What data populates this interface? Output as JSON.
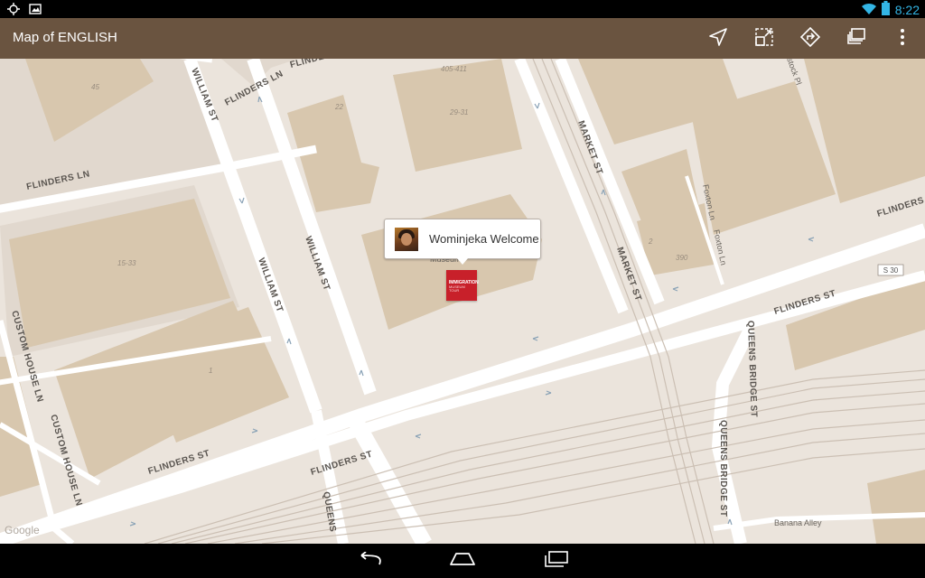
{
  "status_bar": {
    "time": "8:22",
    "icons": [
      "gps-icon",
      "gallery-notification-icon",
      "wifi-icon",
      "battery-icon"
    ]
  },
  "action_bar": {
    "title": "Map of ENGLISH",
    "actions": [
      "navigation-arrow-icon",
      "expand-view-icon",
      "directions-icon",
      "layers-icon",
      "overflow-menu-icon"
    ]
  },
  "map": {
    "callout": {
      "text": "Wominjeka Welcome"
    },
    "marker": {
      "line1": "IMMIGRATION",
      "line2": "MUSEUM",
      "line3": "TOUR"
    },
    "place_label": "Museum",
    "street_labels": {
      "william_st_1": "WILLIAM ST",
      "william_st_2": "WILLIAM ST",
      "william_st_3": "WILLIAM ST",
      "flinders_ln_1": "FLINDERS LN",
      "flinders_ln_2": "FLINDERS LN",
      "flinders_ln_3": "FLINDERS LN",
      "flinders_ln_4": "FLINDERS LN",
      "flinders_st_1": "FLINDERS ST",
      "flinders_st_2": "FLINDERS ST",
      "flinders_st_3": "FLINDERS ST",
      "market_st": "MARKET ST",
      "custom_house_ln_1": "CUSTOM HOUSE LN",
      "custom_house_ln_2": "CUSTOM HOUSE LN",
      "queens_bridge_st_1": "QUEENS BRIDGE ST",
      "queens_bridge_st_2": "QUEENS",
      "foxton_ln_1": "Foxton Ln",
      "foxton_ln_2": "Foxton Ln",
      "banana_alley": "Banana Alley",
      "stock_pl": "stock Pl",
      "route_badge": "S 30"
    },
    "building_numbers": {
      "n45": "45",
      "n405": "405-411",
      "n22": "22",
      "n2931": "29-31",
      "n1533": "15-33",
      "n1": "1",
      "n2": "2",
      "n390": "390"
    },
    "attribution": "Google"
  },
  "nav_bar": {
    "buttons": [
      "back-icon",
      "home-icon",
      "recent-apps-icon"
    ]
  }
}
